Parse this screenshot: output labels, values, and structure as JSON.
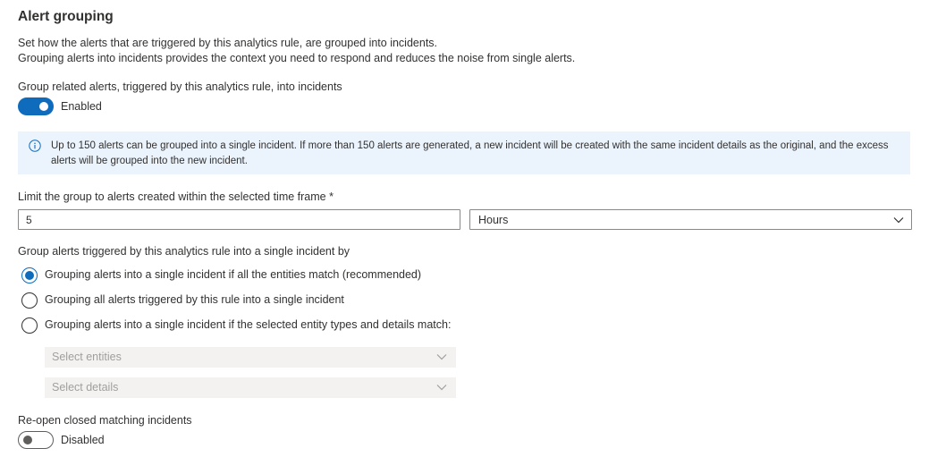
{
  "section": {
    "title": "Alert grouping",
    "description_line1": "Set how the alerts that are triggered by this analytics rule, are grouped into incidents.",
    "description_line2": "Grouping alerts into incidents provides the context you need to respond and reduces the noise from single alerts."
  },
  "group_toggle": {
    "label": "Group related alerts, triggered by this analytics rule, into incidents",
    "state": "Enabled",
    "on": true
  },
  "info": {
    "icon": "info-icon",
    "text": "Up to 150 alerts can be grouped into a single incident. If more than 150 alerts are generated, a new incident will be created with the same incident details as the original, and the excess alerts will be grouped into the new incident."
  },
  "time_frame": {
    "label": "Limit the group to alerts created within the selected time frame *",
    "value": "5",
    "unit": "Hours"
  },
  "grouping_method": {
    "label": "Group alerts triggered by this analytics rule into a single incident by",
    "options": [
      {
        "label": "Grouping alerts into a single incident if all the entities match (recommended)",
        "selected": true
      },
      {
        "label": "Grouping all alerts triggered by this rule into a single incident",
        "selected": false
      },
      {
        "label": "Grouping alerts into a single incident if the selected entity types and details match:",
        "selected": false
      }
    ],
    "entities_placeholder": "Select entities",
    "details_placeholder": "Select details"
  },
  "reopen_toggle": {
    "label": "Re-open closed matching incidents",
    "state": "Disabled",
    "on": false
  },
  "colors": {
    "accent": "#0f6cbd",
    "info_background": "#ebf3fc",
    "text": "#323130",
    "disabled_background": "#f3f2f1"
  }
}
